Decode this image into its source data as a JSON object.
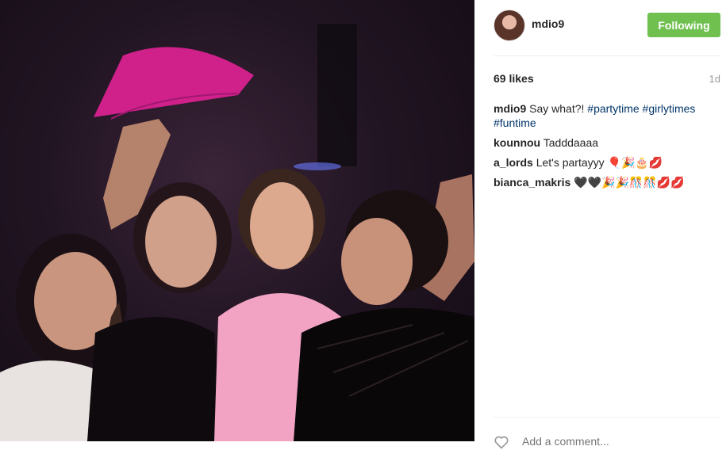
{
  "post": {
    "username": "mdio9",
    "follow_label": "Following",
    "likes": "69 likes",
    "time": "1d"
  },
  "comments": [
    {
      "author": "mdio9",
      "text": "Say what?!",
      "tags": [
        "#partytime",
        "#girlytimes",
        "#funtime"
      ]
    },
    {
      "author": "kounnou",
      "text": "Tadddaaaa"
    },
    {
      "author": "a_lords",
      "text": "Let's partayyy 🎈🎉🎂💋"
    },
    {
      "author": "bianca_makris",
      "text": "🖤🖤🎉🎉🎊🎊💋💋"
    }
  ],
  "comment_box": {
    "placeholder": "Add a comment..."
  },
  "colors": {
    "follow_button": "#70c050",
    "hashtag": "#003569",
    "fan": "#d0208a",
    "dress": "#f2a3c4"
  },
  "icons": {
    "like": "heart-outline-icon"
  }
}
